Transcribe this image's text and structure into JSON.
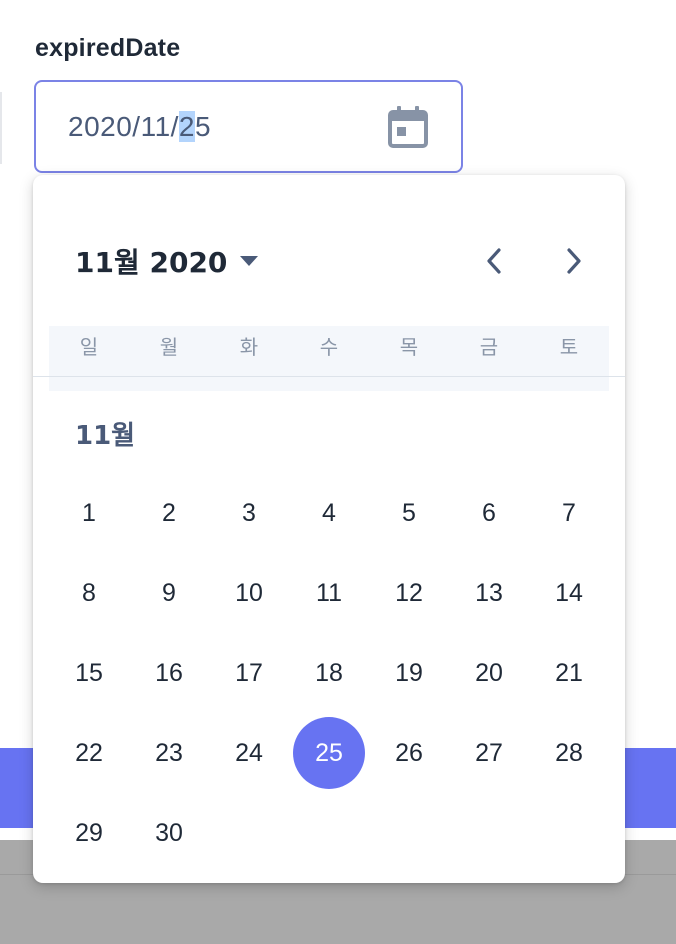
{
  "field": {
    "label": "expiredDate",
    "value_prefix": "2020/11/",
    "value_selected": "2",
    "value_suffix": "5",
    "icon": "calendar-icon"
  },
  "calendar": {
    "header_title": "11월 2020",
    "prev_icon": "chevron-left-icon",
    "next_icon": "chevron-right-icon",
    "dropdown_icon": "caret-down-icon",
    "weekdays": [
      "일",
      "월",
      "화",
      "수",
      "목",
      "금",
      "토"
    ],
    "month_label": "11월",
    "days": [
      "1",
      "2",
      "3",
      "4",
      "5",
      "6",
      "7",
      "8",
      "9",
      "10",
      "11",
      "12",
      "13",
      "14",
      "15",
      "16",
      "17",
      "18",
      "19",
      "20",
      "21",
      "22",
      "23",
      "24",
      "25",
      "26",
      "27",
      "28",
      "29",
      "30"
    ],
    "selected_day": "25",
    "accent_color": "#6773f2"
  }
}
